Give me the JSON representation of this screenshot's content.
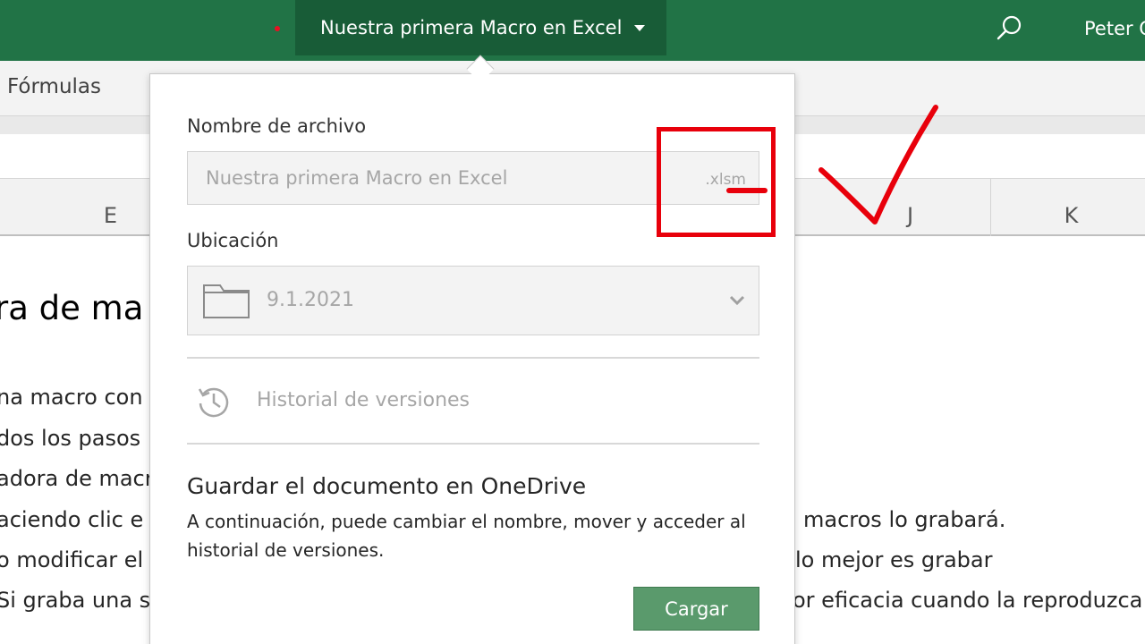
{
  "titlebar": {
    "doc_title": "Nuestra primera Macro en Excel",
    "user": "Peter C",
    "icons": [
      "search-icon",
      "chevron-down-icon"
    ]
  },
  "ribbon": {
    "tab": "Fórmulas"
  },
  "columns": [
    "E",
    "J",
    "K"
  ],
  "sheet": {
    "heading": "ra de ma",
    "lines_left": [
      "na macro con",
      "dos los pasos",
      "adora de macr",
      "aciendo clic e",
      "o modificar el",
      "Si graba una s"
    ],
    "lines_right": [
      "macros lo grabará.",
      "lo mejor es grabar",
      "or eficacia cuando la reproduzca"
    ]
  },
  "dialog": {
    "filename_label": "Nombre de archivo",
    "filename_value": "Nuestra primera Macro en Excel",
    "extension": ".xlsm",
    "location_label": "Ubicación",
    "location_value": "9.1.2021",
    "history": "Historial de versiones",
    "save_title": "Guardar el documento en OneDrive",
    "save_desc": "A continuación, puede cambiar el nombre, mover y acceder al historial de versiones.",
    "upload": "Cargar"
  },
  "colors": {
    "excel_green": "#217346",
    "title_dark_green": "#185c37",
    "button_green": "#5a9a6c",
    "annotation_red": "#e8000b"
  }
}
